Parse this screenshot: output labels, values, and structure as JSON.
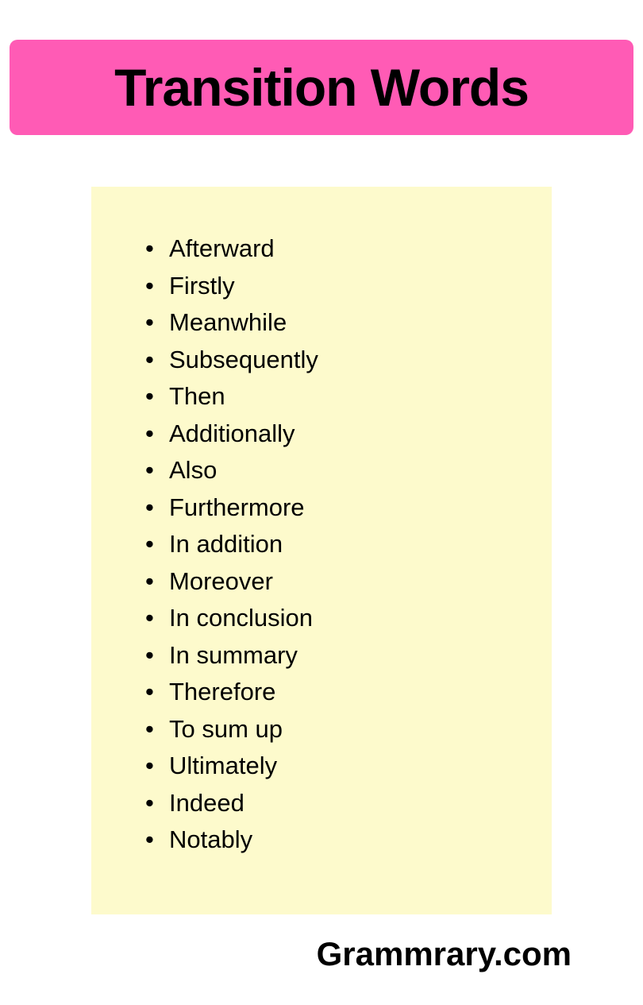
{
  "header": {
    "title": "Transition Words"
  },
  "words": [
    "Afterward",
    "Firstly",
    "Meanwhile",
    "Subsequently",
    "Then",
    "Additionally",
    "Also",
    "Furthermore",
    "In addition",
    "Moreover",
    "In conclusion",
    "In summary",
    "Therefore",
    "To sum up",
    "Ultimately",
    "Indeed",
    "Notably"
  ],
  "footer": {
    "brand": "Grammrary.com"
  }
}
